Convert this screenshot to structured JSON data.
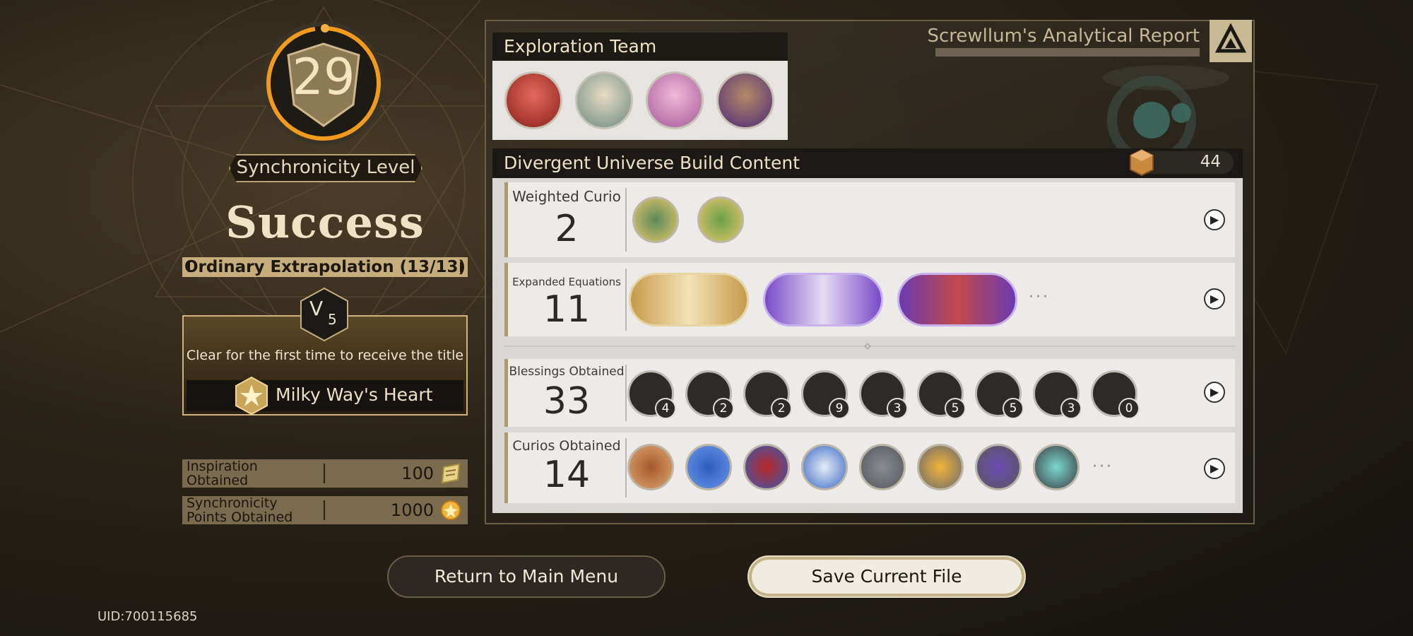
{
  "sync_level": {
    "value": "29",
    "label": "Synchronicity Level",
    "progress": 0.97
  },
  "result": {
    "status": "Success",
    "difficulty": "Ordinary Extrapolation (13/13)"
  },
  "version_badge": {
    "letter": "V",
    "number": "5"
  },
  "title_reward": {
    "description": "Clear for the first time to receive the title",
    "title": "Milky Way's Heart"
  },
  "stats": [
    {
      "label": "Inspiration Obtained",
      "value": "100",
      "icon": "inspiration-icon"
    },
    {
      "label": "Synchronicity Points Obtained",
      "value": "1000",
      "icon": "sync-points-icon"
    }
  ],
  "uid": "UID:700115685",
  "report": {
    "title": "Screwllum's Analytical Report"
  },
  "team": {
    "heading": "Exploration Team",
    "members": [
      "character-red-hair",
      "character-blonde",
      "character-pink-hair",
      "character-brown-hair"
    ]
  },
  "build": {
    "heading": "Divergent Universe Build Content",
    "count": "44",
    "weighted_curio": {
      "label": "Weighted Curio",
      "value": "2"
    },
    "expanded_equations": {
      "label": "Expanded Equations",
      "value": "11"
    },
    "blessings": {
      "label": "Blessings Obtained",
      "value": "33",
      "counts": [
        "4",
        "2",
        "2",
        "9",
        "3",
        "5",
        "5",
        "3",
        "0"
      ]
    },
    "curios": {
      "label": "Curios Obtained",
      "value": "14"
    }
  },
  "buttons": {
    "return": "Return to Main Menu",
    "save": "Save Current File"
  },
  "colors": {
    "accent_gold": "#c7ad7c",
    "ring_orange": "#f29a1c",
    "panel_dark": "#1b1815",
    "card_light": "#ecebe9"
  }
}
